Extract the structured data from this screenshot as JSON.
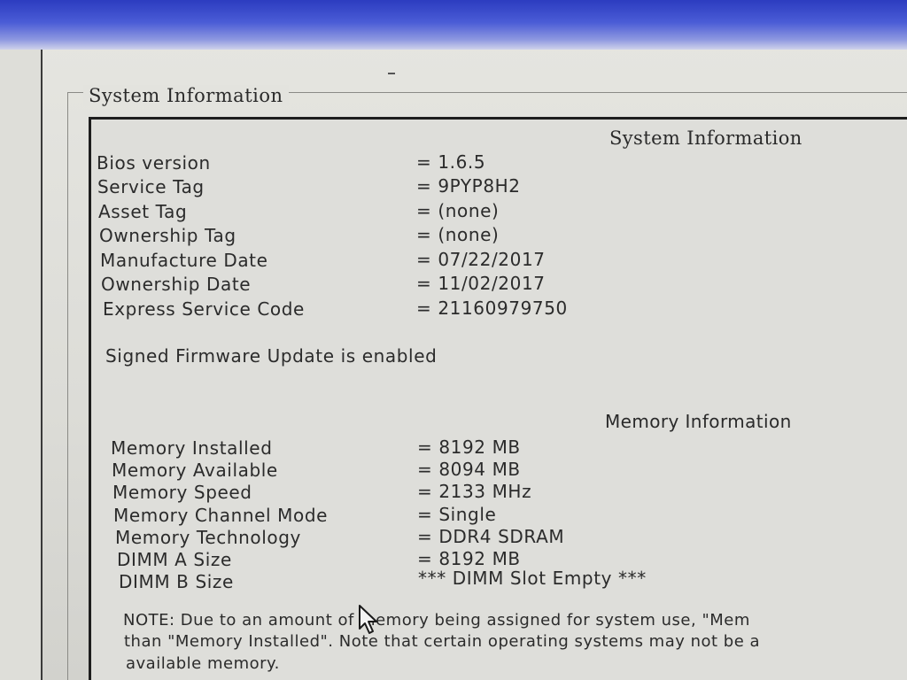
{
  "window": {
    "group_title": "System Information"
  },
  "system_info": {
    "heading": "System Information",
    "rows": [
      {
        "label": "Bios version",
        "value": "= 1.6.5"
      },
      {
        "label": "Service Tag",
        "value": "= 9PYP8H2"
      },
      {
        "label": "Asset Tag",
        "value": "= (none)"
      },
      {
        "label": "Ownership Tag",
        "value": "= (none)"
      },
      {
        "label": "Manufacture Date",
        "value": "= 07/22/2017"
      },
      {
        "label": "Ownership Date",
        "value": "= 11/02/2017"
      },
      {
        "label": "Express Service Code",
        "value": "= 21160979750"
      }
    ],
    "firmware_notice": "Signed Firmware Update is enabled"
  },
  "memory_info": {
    "heading": "Memory Information",
    "rows": [
      {
        "label": "Memory Installed",
        "value": "= 8192 MB"
      },
      {
        "label": "Memory Available",
        "value": "= 8094 MB"
      },
      {
        "label": "Memory Speed",
        "value": "= 2133 MHz"
      },
      {
        "label": "Memory Channel Mode",
        "value": "= Single"
      },
      {
        "label": "Memory Technology",
        "value": "= DDR4 SDRAM"
      },
      {
        "label": "DIMM A Size",
        "value": "= 8192 MB"
      },
      {
        "label": "DIMM B Size",
        "value": "*** DIMM Slot Empty ***"
      }
    ],
    "note_lines": [
      "NOTE: Due to an amount of memory being assigned for system use, \"Mem",
      "than \"Memory Installed\". Note that certain operating systems may not be a",
      "available memory."
    ]
  },
  "icons": {
    "cursor": "mouse-pointer-icon"
  }
}
